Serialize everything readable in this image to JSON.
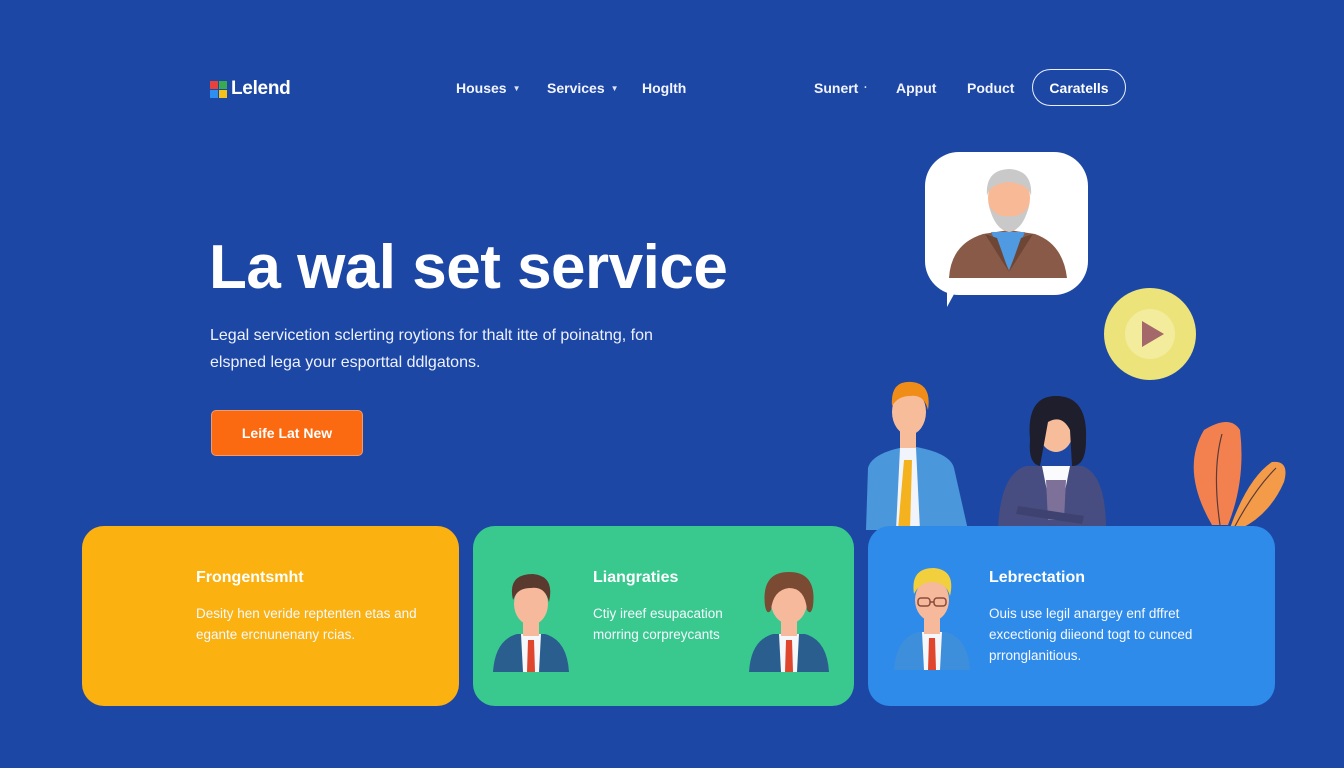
{
  "brand": {
    "name": "Lelend",
    "logo_colors": [
      "#e8413a",
      "#3aaa4e",
      "#2f8ff0",
      "#f4c21b"
    ]
  },
  "nav": {
    "items": [
      {
        "label": "Houses",
        "has_dropdown": true
      },
      {
        "label": "Services",
        "has_dropdown": true
      },
      {
        "label": "Hoglth",
        "has_dropdown": false
      },
      {
        "label": "Sunert",
        "has_dropdown": true
      },
      {
        "label": "Apput",
        "has_dropdown": false
      },
      {
        "label": "Poduct",
        "has_dropdown": false
      }
    ],
    "cta_label": "Caratells"
  },
  "hero": {
    "title": "La wal set service",
    "subtitle": "Legal servicetion sclerting roytions for thalt itte of poinatng, fon elspned lega your esporttal ddlgatons.",
    "button_label": "Leife Lat New"
  },
  "cards": [
    {
      "title": "Frongentsmht",
      "text": "Desity hen veride reptenten etas and egante ercnunenany rcias.",
      "color": "#fbb10f"
    },
    {
      "title": "Liangraties",
      "text": "Ctiy ireef esupacation morring corpreycants",
      "color": "#39c98f"
    },
    {
      "title": "Lebrectation",
      "text": "Ouis use legil anargey enf dffret excectionig diieond togt to cunced prronglanitious.",
      "color": "#2f8bea"
    }
  ],
  "colors": {
    "background": "#1d47a4",
    "cta_orange": "#fb6a11",
    "play_yellow": "#ece37a"
  }
}
